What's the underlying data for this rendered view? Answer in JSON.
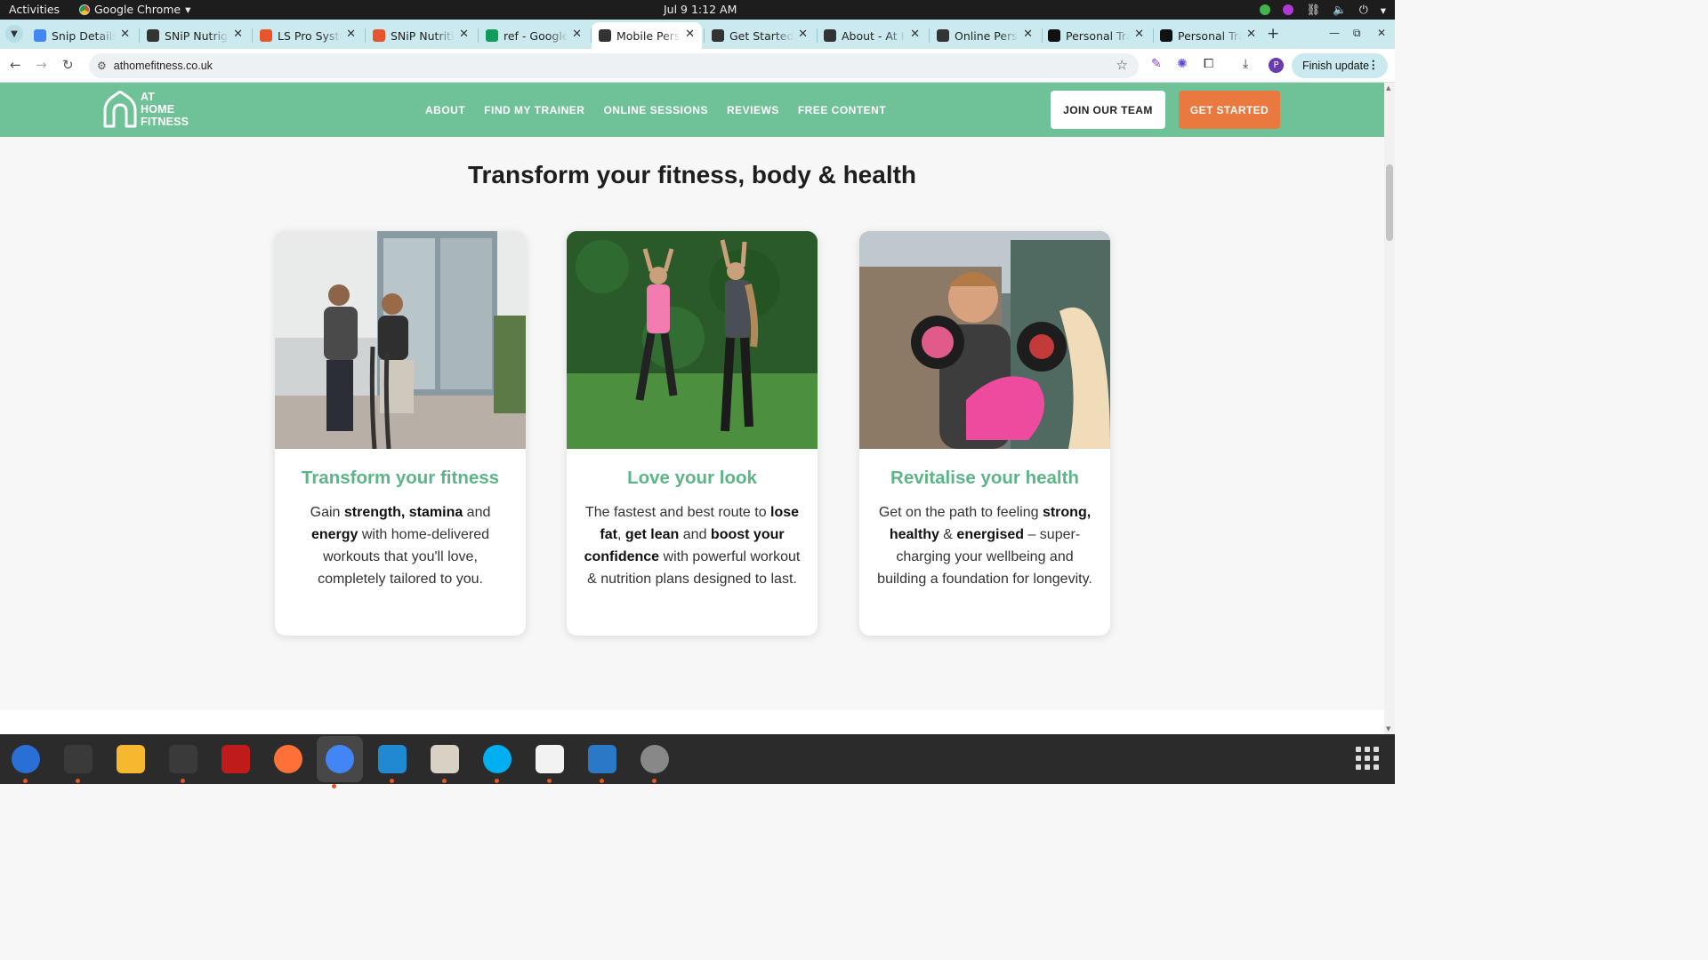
{
  "system_bar": {
    "activities": "Activities",
    "app_name": "Google Chrome",
    "clock": "Jul 9   1:12 AM"
  },
  "browser": {
    "tabs": [
      {
        "title": "Snip Details",
        "favicon": "docs-icon",
        "color": "#4285f4"
      },
      {
        "title": "SNiP Nutrigi",
        "favicon": "snip-icon",
        "color": "#333333"
      },
      {
        "title": "LS Pro Syste",
        "favicon": "ls-icon",
        "color": "#e8542c"
      },
      {
        "title": "SNiP Nutritio",
        "favicon": "ls-icon",
        "color": "#e8542c"
      },
      {
        "title": "ref - Google",
        "favicon": "sheets-icon",
        "color": "#0f9d58"
      },
      {
        "title": "Mobile Pers",
        "favicon": "athome-icon",
        "color": "#333333",
        "active": true
      },
      {
        "title": "Get Started",
        "favicon": "athome-icon",
        "color": "#333333"
      },
      {
        "title": "About - At H",
        "favicon": "athome-icon",
        "color": "#333333"
      },
      {
        "title": "Online Perso",
        "favicon": "athome-icon",
        "color": "#333333"
      },
      {
        "title": "Personal Tra",
        "favicon": "fs-icon",
        "color": "#111111"
      },
      {
        "title": "Personal Tra",
        "favicon": "fs-icon",
        "color": "#111111"
      }
    ],
    "url": "athomefitness.co.uk",
    "finish_update": "Finish update",
    "profile_initial": "P"
  },
  "site": {
    "logo_lines": [
      "AT",
      "HOME",
      "FITNESS"
    ],
    "nav": [
      "ABOUT",
      "FIND MY TRAINER",
      "ONLINE SESSIONS",
      "REVIEWS",
      "FREE CONTENT"
    ],
    "join_button": "JOIN OUR TEAM",
    "start_button": "GET STARTED",
    "heading": "Transform your fitness, body & health",
    "cards": [
      {
        "title": "Transform your fitness",
        "text": [
          {
            "t": "Gain "
          },
          {
            "t": "strength, stamina",
            "b": true
          },
          {
            "t": " and "
          },
          {
            "t": "energy",
            "b": true
          },
          {
            "t": " with home-delivered workouts that you'll love, completely tailored to you."
          }
        ],
        "photo": "trainer-battle-ropes-photo"
      },
      {
        "title": "Love your look",
        "text": [
          {
            "t": "The fastest and best route to "
          },
          {
            "t": "lose fat",
            "b": true
          },
          {
            "t": ", "
          },
          {
            "t": "get lean",
            "b": true
          },
          {
            "t": " and "
          },
          {
            "t": "boost your confidence",
            "b": true
          },
          {
            "t": " with powerful workout & nutrition plans designed to last."
          }
        ],
        "photo": "garden-workout-photo"
      },
      {
        "title": "Revitalise your health",
        "text": [
          {
            "t": "Get on the path to feeling "
          },
          {
            "t": "strong, healthy",
            "b": true
          },
          {
            "t": " & "
          },
          {
            "t": "energised",
            "b": true
          },
          {
            "t": " – super-charging your wellbeing and building a foundation for longevity."
          }
        ],
        "photo": "boxing-pads-photo"
      }
    ]
  },
  "dock": [
    {
      "name": "thunderbird-icon",
      "color": "#2a6fd6"
    },
    {
      "name": "terminal-icon",
      "color": "#3a3a3a"
    },
    {
      "name": "calculator-icon",
      "color": "#f5b82e"
    },
    {
      "name": "system-monitor-icon",
      "color": "#3a3a3a"
    },
    {
      "name": "filezilla-icon",
      "color": "#bf1b1b"
    },
    {
      "name": "firefox-icon",
      "color": "#ff7139"
    },
    {
      "name": "chrome-icon",
      "color": "#4285f4"
    },
    {
      "name": "vscode-icon",
      "color": "#1f8ad2"
    },
    {
      "name": "files-icon",
      "color": "#d8d2c4"
    },
    {
      "name": "skype-icon",
      "color": "#00aff0"
    },
    {
      "name": "text-editor-icon",
      "color": "#f2f2f2"
    },
    {
      "name": "writer-icon",
      "color": "#2a78c6"
    },
    {
      "name": "disk-icon",
      "color": "#888888"
    }
  ],
  "colors": {
    "brand_green": "#6fc198",
    "title_green": "#5cb587",
    "cta_orange": "#e9793f"
  }
}
